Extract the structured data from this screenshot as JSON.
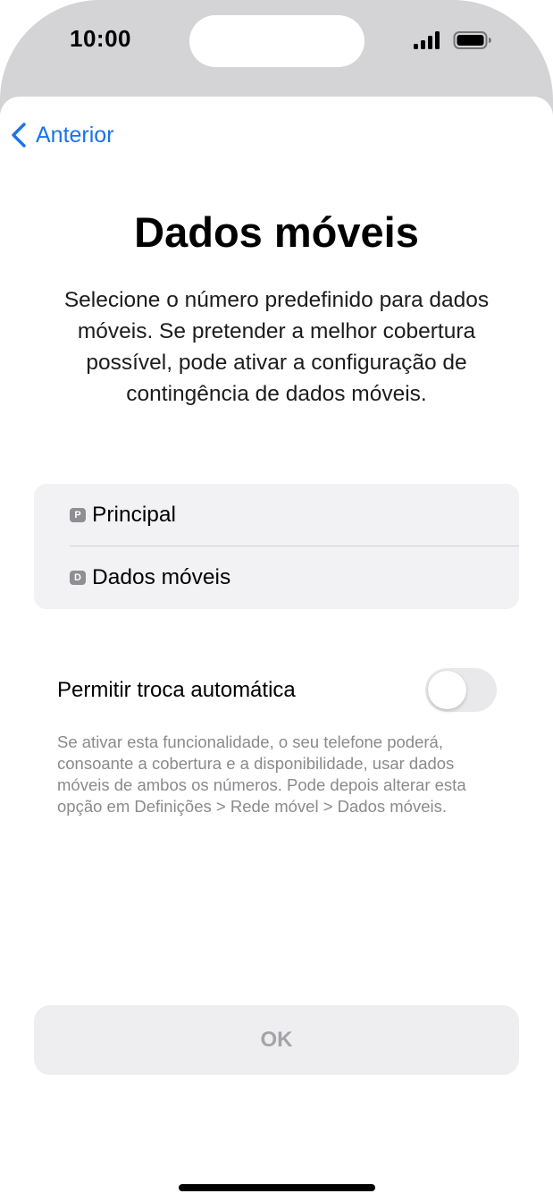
{
  "status_bar": {
    "time": "10:00",
    "icons": [
      "signal-icon",
      "battery-icon"
    ]
  },
  "nav": {
    "back_label": "Anterior",
    "back_icon": "chevron-left-icon"
  },
  "page": {
    "title": "Dados móveis",
    "description": "Selecione o número predefinido para dados móveis. Se pretender a melhor cobertura possível, pode ativar a configuração de contingência de dados móveis."
  },
  "lines": [
    {
      "badge": "P",
      "label": "Principal"
    },
    {
      "badge": "D",
      "label": "Dados móveis"
    }
  ],
  "auto_switch": {
    "label": "Permitir troca automática",
    "enabled": false,
    "footer": "Se ativar esta funcionalidade, o seu telefone poderá, consoante a cobertura e a disponibilidade, usar dados móveis de ambos os números. Pode depois alterar esta opção em Definições > Rede móvel > Dados móveis."
  },
  "ok_button": {
    "label": "OK",
    "enabled": false
  },
  "colors": {
    "accent": "#1a73e8",
    "background_dim": "#d4d4d6",
    "group_background": "#f2f2f4",
    "secondary_text": "#8a8a8e",
    "disabled_button": "#eeeef0"
  }
}
